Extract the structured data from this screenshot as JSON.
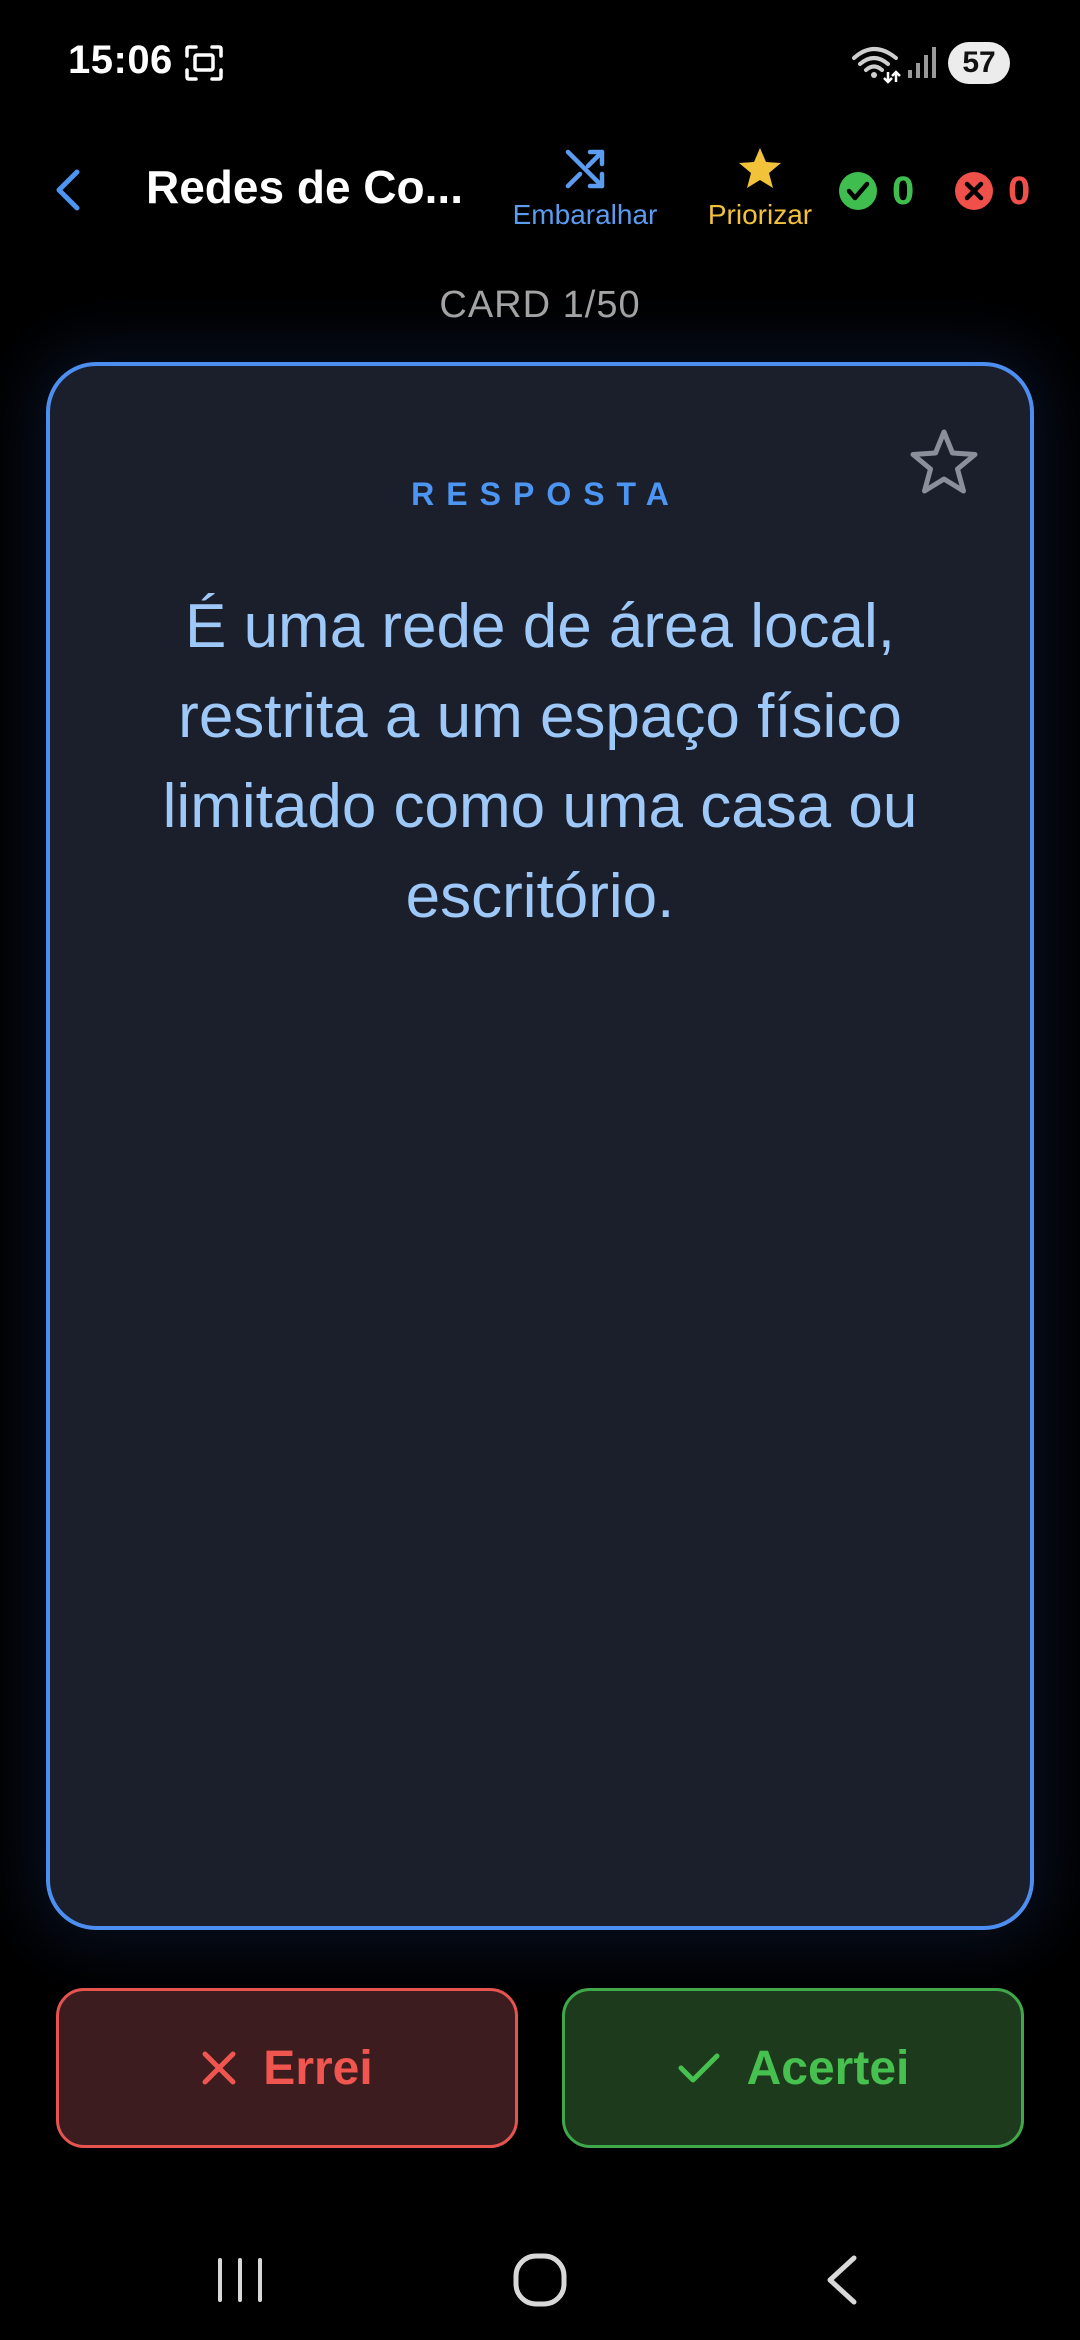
{
  "status_bar": {
    "time": "15:06",
    "battery": "57",
    "icons": [
      "screen-capture-icon",
      "wifi-icon",
      "signal-icon",
      "battery-icon"
    ]
  },
  "top_bar": {
    "deck_title": "Redes de Co...",
    "shuffle_label": "Embaralhar",
    "priority_label": "Priorizar",
    "correct_count": "0",
    "wrong_count": "0",
    "icons": [
      "back-chevron-icon",
      "shuffle-icon",
      "star-icon",
      "check-circle-icon",
      "x-circle-icon"
    ]
  },
  "card": {
    "counter": "CARD 1/50",
    "side_label": "RESPOSTA",
    "text": "É uma rede de área local, restrita a um espaço físico limitado como uma casa ou escritório."
  },
  "actions": {
    "wrong_label": "Errei",
    "correct_label": "Acertei"
  },
  "colors": {
    "background": "#000000",
    "card_background": "#1b1f2c",
    "card_border": "#4c8ff0",
    "card_text": "#9ec8f8",
    "accent_blue": "#4d95f2",
    "priority_yellow": "#f2c23a",
    "correct_green": "#3fbe4f",
    "wrong_red": "#f0504a"
  }
}
